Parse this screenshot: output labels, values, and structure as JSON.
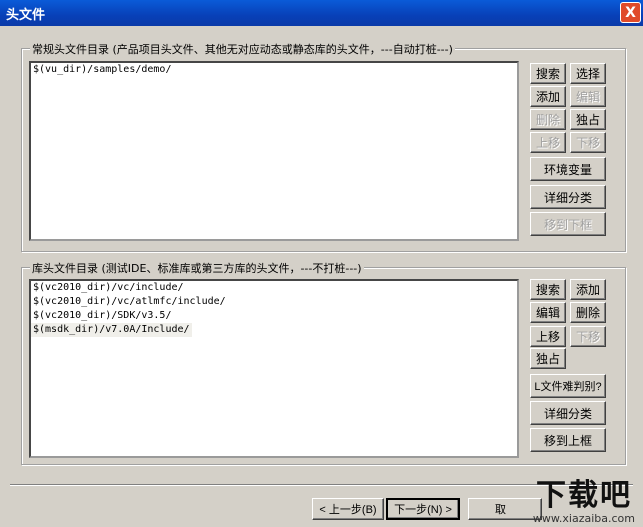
{
  "window": {
    "title": "头文件",
    "close_label": "X"
  },
  "group1": {
    "label": "常规头文件目录 (产品项目头文件、其他无对应动态或静态库的头文件，---自动打桩---)",
    "items": [
      "$(vu_dir)/samples/demo/"
    ],
    "buttons": {
      "search": "搜索",
      "select": "选择",
      "add": "添加",
      "edit": "编辑",
      "delete": "删除",
      "exclusive": "独占",
      "up": "上移",
      "down": "下移",
      "env": "环境变量",
      "detail": "详细分类",
      "move_down": "移到下框"
    }
  },
  "group2": {
    "label": "库头文件目录 (测试IDE、标准库或第三方库的头文件，---不打桩---)",
    "items": [
      "$(vc2010_dir)/vc/include/",
      "$(vc2010_dir)/vc/atlmfc/include/",
      "$(vc2010_dir)/SDK/v3.5/",
      "$(msdk_dir)/v7.0A/Include/"
    ],
    "buttons": {
      "search": "搜索",
      "add": "添加",
      "edit": "编辑",
      "delete": "删除",
      "up": "上移",
      "down": "下移",
      "exclusive": "独占",
      "judge": "L文件难判别?",
      "detail": "详细分类",
      "move_up": "移到上框"
    }
  },
  "footer": {
    "prev": "< 上一步(B)",
    "next": "下一步(N) >",
    "cancel": "取"
  },
  "watermark": {
    "brand": "下载吧",
    "url": "www.xiazaiba.com"
  }
}
